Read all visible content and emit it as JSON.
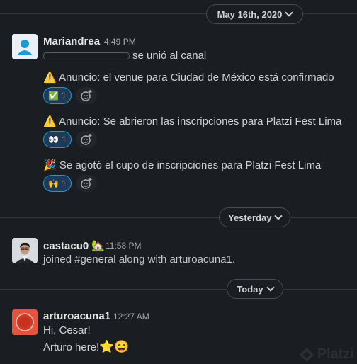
{
  "dates": {
    "first": "May 16th, 2020",
    "second": "Yesterday",
    "third": "Today"
  },
  "messages": {
    "mariandrea": {
      "name": "Mariandrea",
      "time": "4:49 PM",
      "joined": "se unió al canal",
      "posts": [
        {
          "emoji": "⚠️",
          "text": "Anuncio: el venue para Ciudad de México está confirmado",
          "reaction_emoji": "✅",
          "reaction_count": "1"
        },
        {
          "emoji": "⚠️",
          "text": "Anuncio: Se abrieron las inscripciones para Platzi Fest Lima",
          "reaction_emoji": "👀",
          "reaction_count": "1"
        },
        {
          "emoji": "🎉",
          "text": "Se agotó el cupo de inscripciones para Platzi Fest Lima",
          "reaction_emoji": "🙌",
          "reaction_count": "1"
        }
      ]
    },
    "castacu": {
      "name": "castacu0",
      "status_emoji": "🏡",
      "time": "11:58 PM",
      "text": "joined #general along with arturoacuna1."
    },
    "arturo": {
      "name": "arturoacuna1",
      "time": "12:27 AM",
      "line1": "Hi, Cesar!",
      "line2": "Arturo here!",
      "line2_emojis": "⭐😄"
    }
  },
  "watermark": "Platzi"
}
